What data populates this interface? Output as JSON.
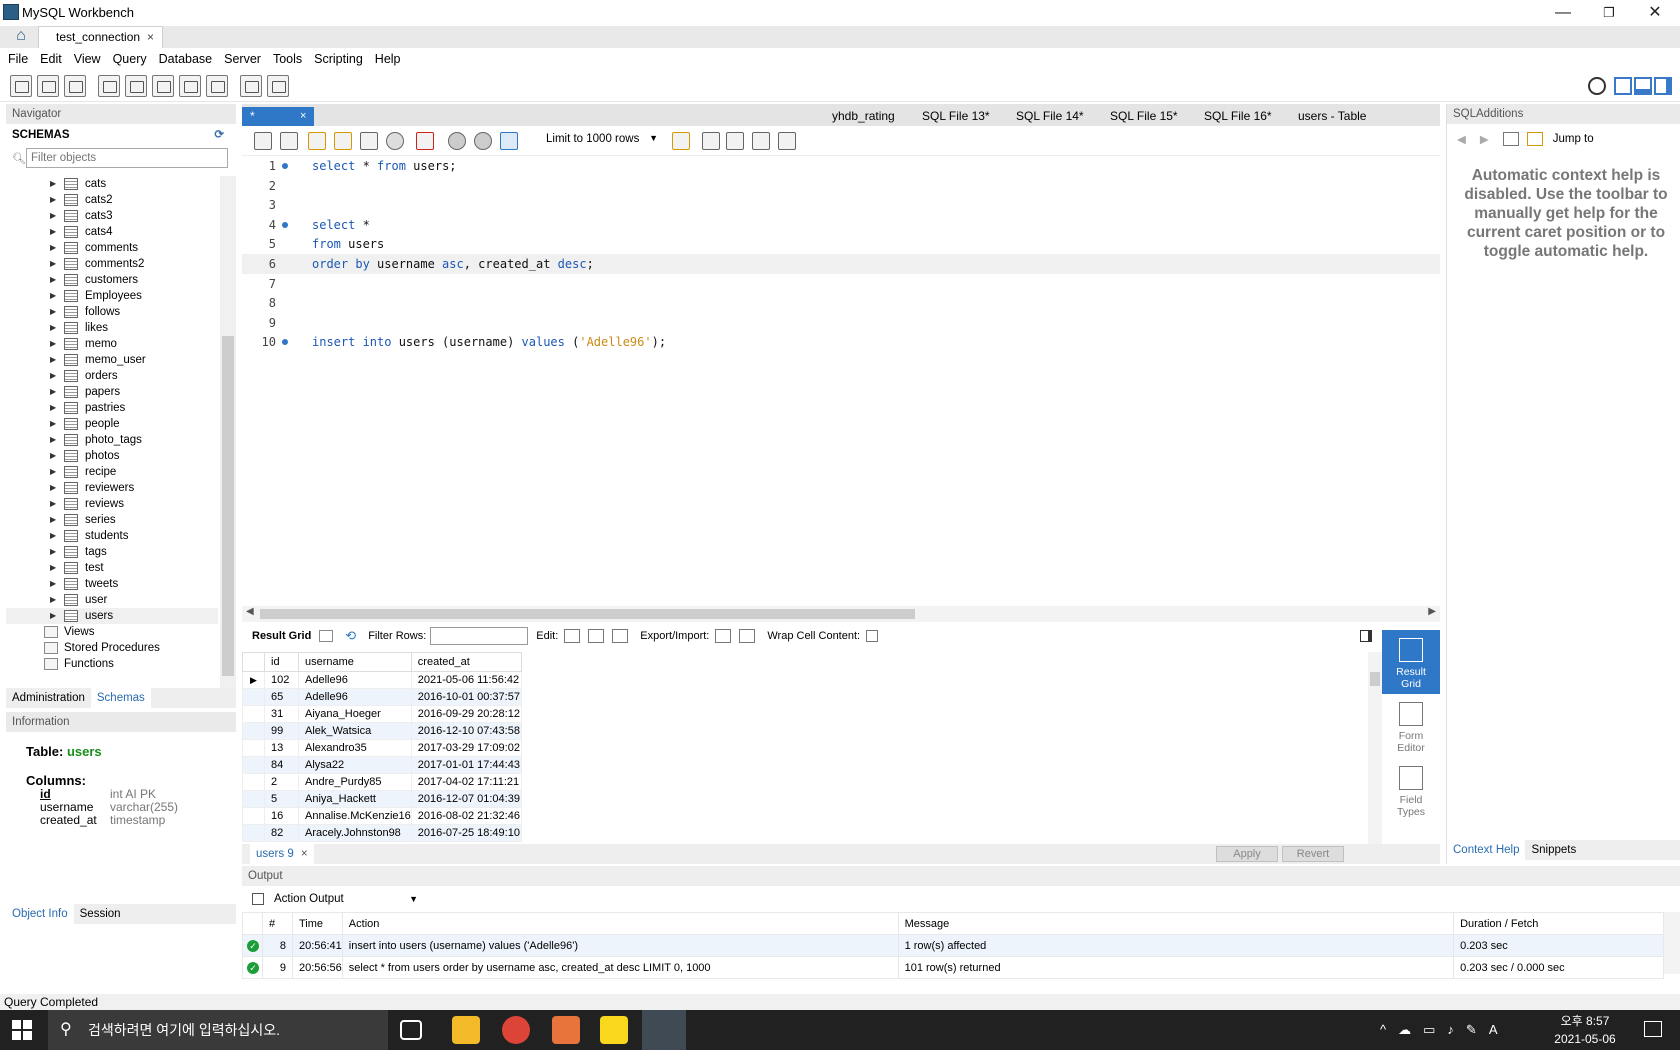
{
  "window": {
    "title": "MySQL Workbench",
    "minimize": "—",
    "restore": "❐",
    "close": "✕"
  },
  "connection_tab": {
    "home_icon": "⌂",
    "label": "test_connection",
    "close": "×"
  },
  "menu": [
    "File",
    "Edit",
    "View",
    "Query",
    "Database",
    "Server",
    "Tools",
    "Scripting",
    "Help"
  ],
  "navigator": {
    "header": "Navigator",
    "schemas_label": "SCHEMAS",
    "filter_placeholder": "Filter objects",
    "tables": [
      "cats",
      "cats2",
      "cats3",
      "cats4",
      "comments",
      "comments2",
      "customers",
      "Employees",
      "follows",
      "likes",
      "memo",
      "memo_user",
      "orders",
      "papers",
      "pastries",
      "people",
      "photo_tags",
      "photos",
      "recipe",
      "reviewers",
      "reviews",
      "series",
      "students",
      "tags",
      "test",
      "tweets",
      "user",
      "users"
    ],
    "sub_items": [
      "Views",
      "Stored Procedures",
      "Functions"
    ],
    "tabs": [
      "Administration",
      "Schemas"
    ],
    "info_header": "Information",
    "info_table_label": "Table:",
    "info_table_name": "users",
    "columns_label": "Columns:",
    "columns": [
      {
        "name": "id",
        "type": "int AI PK"
      },
      {
        "name": "username",
        "type": "varchar(255)"
      },
      {
        "name": "created_at",
        "type": "timestamp"
      }
    ],
    "bottom_tabs": [
      "Object Info",
      "Session"
    ]
  },
  "sql_tabs": {
    "active": "*",
    "active_close": "×",
    "others": [
      "yhdb_rating",
      "SQL File 13*",
      "SQL File 14*",
      "SQL File 15*",
      "SQL File 16*",
      "users - Table"
    ]
  },
  "sql_toolbar": {
    "limit": "Limit to 1000 rows"
  },
  "code_lines": [
    {
      "n": "1",
      "dot": true,
      "html": "<span class='kw'>select</span> * <span class='kw'>from</span> users;"
    },
    {
      "n": "2",
      "dot": false,
      "html": ""
    },
    {
      "n": "3",
      "dot": false,
      "html": ""
    },
    {
      "n": "4",
      "dot": true,
      "html": "<span class='kw'>select</span> *"
    },
    {
      "n": "5",
      "dot": false,
      "html": "<span class='kw'>from</span> users"
    },
    {
      "n": "6",
      "dot": false,
      "html": "<span class='kw'>order by</span> username <span class='kw'>asc</span>, created_at <span class='kw'>desc</span>;",
      "hl": true
    },
    {
      "n": "7",
      "dot": false,
      "html": ""
    },
    {
      "n": "8",
      "dot": false,
      "html": ""
    },
    {
      "n": "9",
      "dot": false,
      "html": ""
    },
    {
      "n": "10",
      "dot": true,
      "html": "<span class='kw'>insert into</span> users (username) <span class='kw'>values</span> (<span class='str'>'Adelle96'</span>);"
    }
  ],
  "result_toolbar": {
    "result_grid": "Result Grid",
    "filter_rows": "Filter Rows:",
    "edit": "Edit:",
    "export_import": "Export/Import:",
    "wrap": "Wrap Cell Content:"
  },
  "result_columns": [
    "id",
    "username",
    "created_at"
  ],
  "result_rows": [
    [
      "102",
      "Adelle96",
      "2021-05-06 11:56:42"
    ],
    [
      "65",
      "Adelle96",
      "2016-10-01 00:37:57"
    ],
    [
      "31",
      "Aiyana_Hoeger",
      "2016-09-29 20:28:12"
    ],
    [
      "99",
      "Alek_Watsica",
      "2016-12-10 07:43:58"
    ],
    [
      "13",
      "Alexandro35",
      "2017-03-29 17:09:02"
    ],
    [
      "84",
      "Alysa22",
      "2017-01-01 17:44:43"
    ],
    [
      "2",
      "Andre_Purdy85",
      "2017-04-02 17:11:21"
    ],
    [
      "5",
      "Aniya_Hackett",
      "2016-12-07 01:04:39"
    ],
    [
      "16",
      "Annalise.McKenzie16",
      "2016-08-02 21:32:46"
    ],
    [
      "82",
      "Aracely.Johnston98",
      "2016-07-25 18:49:10"
    ]
  ],
  "side_buttons": [
    {
      "label1": "Result",
      "label2": "Grid"
    },
    {
      "label1": "Form",
      "label2": "Editor"
    },
    {
      "label1": "Field",
      "label2": "Types"
    }
  ],
  "result_footer": {
    "tab": "users 9",
    "tab_close": "×",
    "apply": "Apply",
    "revert": "Revert"
  },
  "sql_additions": {
    "header": "SQLAdditions",
    "jump_to": "Jump to",
    "help": "Automatic context help is disabled. Use the toolbar to manually get help for the current caret position or to toggle automatic help.",
    "tabs": [
      "Context Help",
      "Snippets"
    ]
  },
  "output": {
    "header": "Output",
    "selector": "Action Output",
    "columns": [
      "#",
      "Time",
      "Action",
      "Message",
      "Duration / Fetch"
    ],
    "rows": [
      [
        "8",
        "20:56:41",
        "insert into users (username) values ('Adelle96')",
        "1 row(s) affected",
        "0.203 sec"
      ],
      [
        "9",
        "20:56:56",
        "select * from users order by username asc, created_at desc LIMIT 0, 1000",
        "101 row(s) returned",
        "0.203 sec / 0.000 sec"
      ]
    ]
  },
  "status": "Query Completed",
  "taskbar": {
    "search_placeholder": "검색하려면 여기에 입력하십시오.",
    "time": "오후 8:57",
    "date": "2021-05-06",
    "ime": "A"
  },
  "colors": {
    "accent": "#2f77c7",
    "keyword": "#1c58b5",
    "string": "#c98a12",
    "ok": "#1b9e3a"
  }
}
